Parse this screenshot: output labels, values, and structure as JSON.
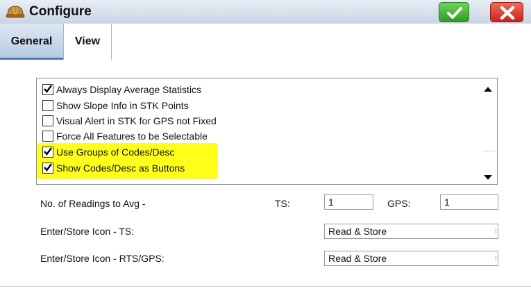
{
  "window": {
    "title": "Configure",
    "icons": {
      "app": "hardhat-icon",
      "ok": "checkmark-icon",
      "cancel": "close-x-icon"
    },
    "colors": {
      "ok": "#3fae2f",
      "cancel": "#d83a2c",
      "highlight": "#ffff00",
      "tab_active": "#c9d8ea"
    }
  },
  "tabs": [
    {
      "label": "General",
      "active": true
    },
    {
      "label": "View",
      "active": false
    }
  ],
  "options": [
    {
      "label": "Always Display Average Statistics",
      "checked": true,
      "highlighted": false
    },
    {
      "label": "Show Slope Info in STK Points",
      "checked": false,
      "highlighted": false
    },
    {
      "label": "Visual Alert in STK for GPS not Fixed",
      "checked": false,
      "highlighted": false
    },
    {
      "label": "Force All Features to be Selectable",
      "checked": false,
      "highlighted": false
    },
    {
      "label": "Use Groups of Codes/Desc",
      "checked": true,
      "highlighted": true
    },
    {
      "label": "Show Codes/Desc as Buttons",
      "checked": true,
      "highlighted": true
    }
  ],
  "readings": {
    "label": "No. of Readings to Avg  -",
    "ts_label": "TS:",
    "ts_value": "1",
    "gps_label": "GPS:",
    "gps_value": "1"
  },
  "enter_store_ts": {
    "label": "Enter/Store Icon - TS:",
    "value": "Read & Store"
  },
  "enter_store_rts": {
    "label": "Enter/Store Icon - RTS/GPS:",
    "value": "Read & Store"
  }
}
